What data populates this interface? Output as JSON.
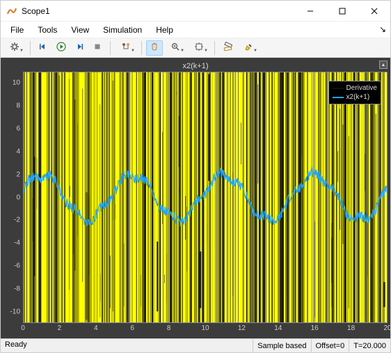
{
  "window": {
    "title": "Scope1"
  },
  "menu": {
    "items": [
      "File",
      "Tools",
      "View",
      "Simulation",
      "Help"
    ]
  },
  "toolbar": {
    "buttons": [
      {
        "name": "configure",
        "icon": "gear",
        "dd": true
      },
      {
        "sep": true
      },
      {
        "name": "step-back",
        "icon": "step-back"
      },
      {
        "name": "run",
        "icon": "play"
      },
      {
        "name": "step-forward",
        "icon": "step-fwd"
      },
      {
        "name": "stop",
        "icon": "stop"
      },
      {
        "sep": true
      },
      {
        "name": "trigger-settings",
        "icon": "trigger",
        "dd": true
      },
      {
        "sep": true
      },
      {
        "name": "pan",
        "icon": "hand",
        "active": true
      },
      {
        "name": "zoom",
        "icon": "zoom",
        "dd": true
      },
      {
        "name": "autoscale",
        "icon": "autoscale",
        "dd": true
      },
      {
        "sep": true
      },
      {
        "name": "measurements",
        "icon": "ruler"
      },
      {
        "name": "highlight",
        "icon": "marker",
        "dd": true
      }
    ]
  },
  "plot": {
    "title": "x2(k+1)",
    "yticks": [
      -10,
      -8,
      -6,
      -4,
      -2,
      0,
      2,
      4,
      6,
      8,
      10
    ],
    "xticks": [
      0,
      2,
      4,
      6,
      8,
      10,
      12,
      14,
      16,
      18,
      20
    ],
    "xlim": [
      0,
      20
    ],
    "ylim": [
      -11,
      11
    ],
    "legend": [
      {
        "label": "Derivative",
        "color": "#111111"
      },
      {
        "label": "x2(k+1)",
        "color": "#1fa4ff"
      }
    ]
  },
  "chart_data": {
    "type": "line",
    "title": "x2(k+1)",
    "xlabel": "",
    "ylabel": "",
    "xlim": [
      0,
      20
    ],
    "ylim": [
      -11,
      11
    ],
    "series": [
      {
        "name": "Derivative",
        "note": "spiky signal filling full y-range, rendered as dense ±11 spikes"
      },
      {
        "name": "x2(k+1)",
        "note": "noisy sinusoid approx 2*sin(2*pi*x/5) + noise, amplitude ~2, period ~5"
      }
    ]
  },
  "status": {
    "ready": "Ready",
    "sample": "Sample based",
    "offset": "Offset=0",
    "time": "T=20.000"
  }
}
